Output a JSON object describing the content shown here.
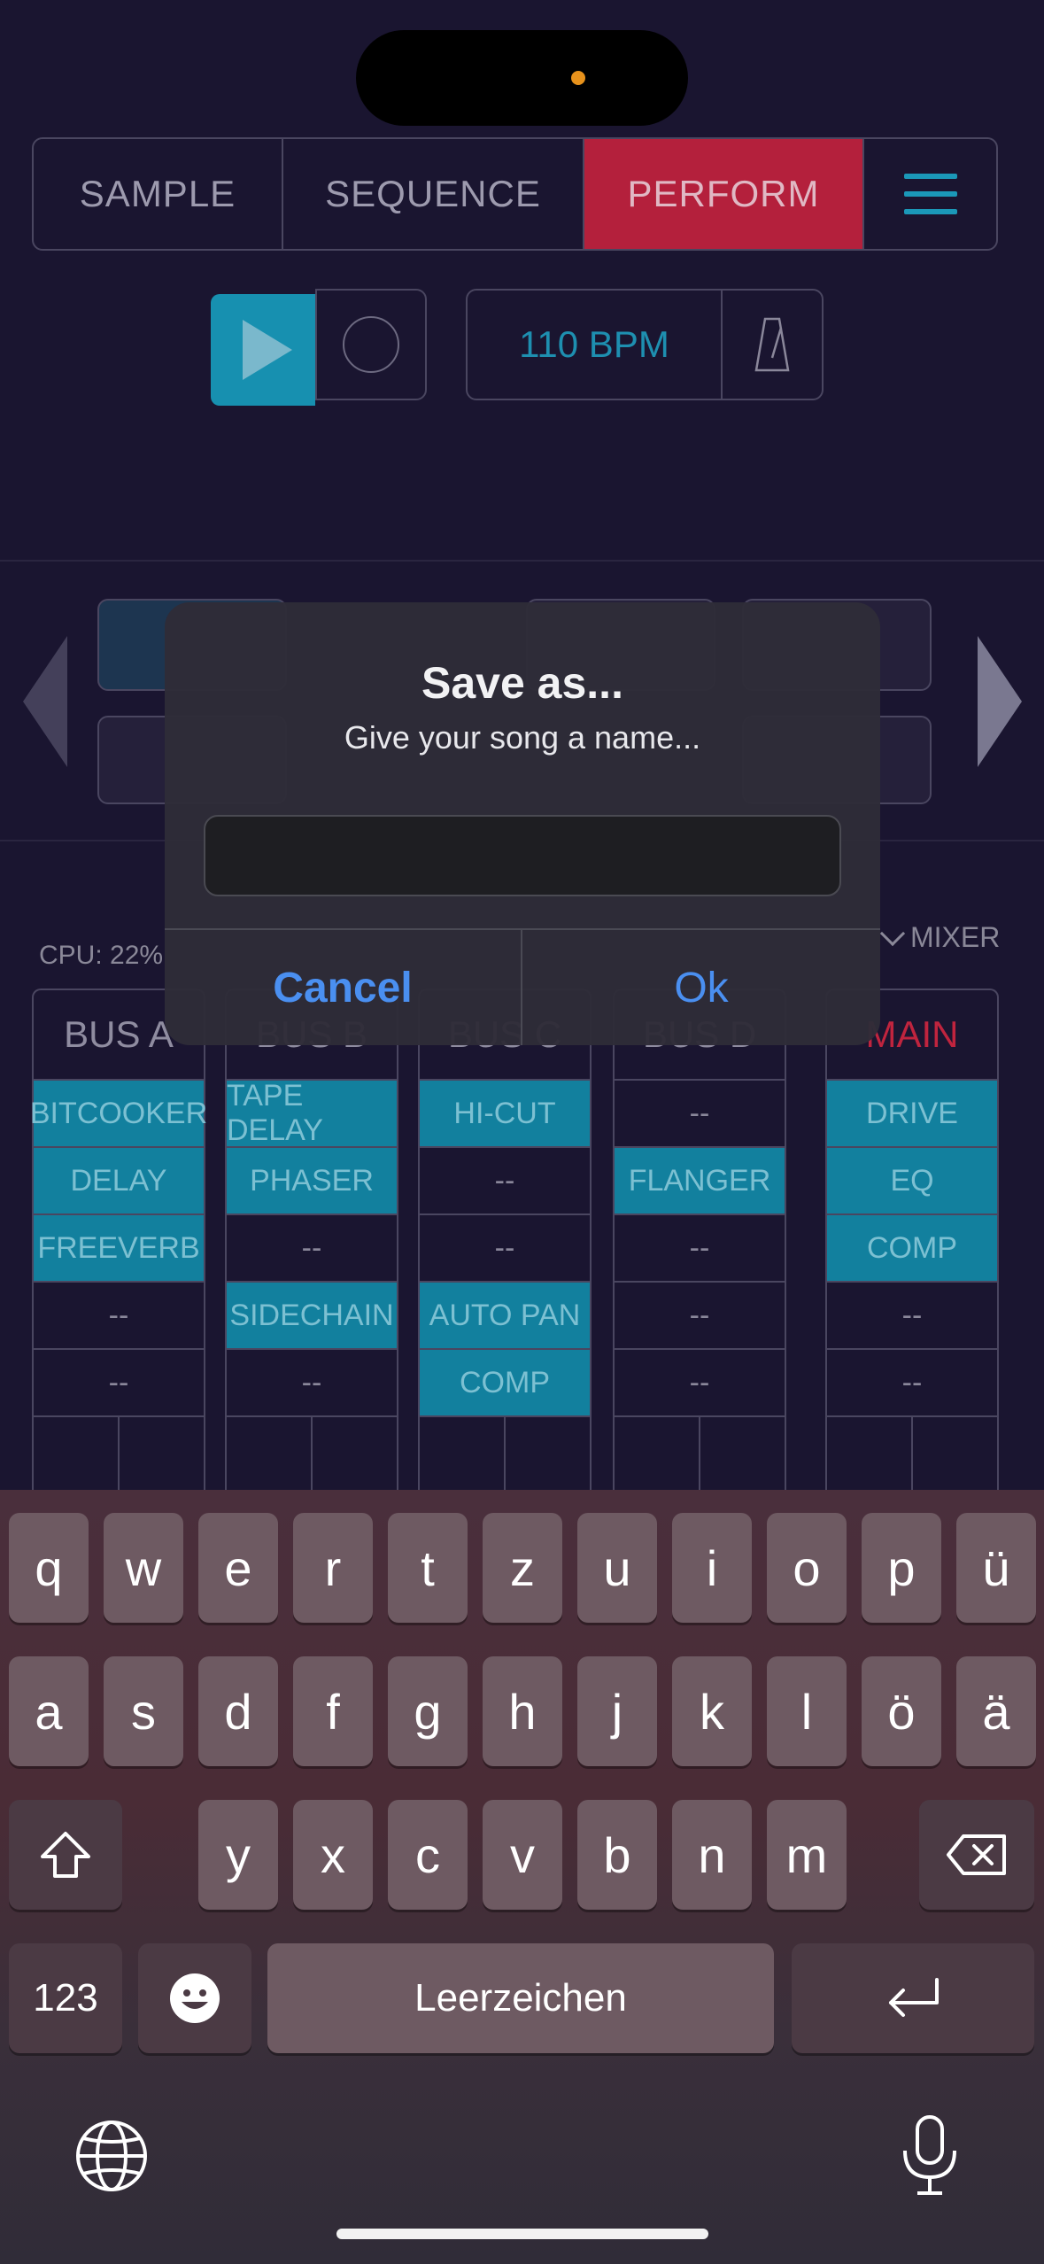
{
  "tabs": {
    "sample": "SAMPLE",
    "sequence": "SEQUENCE",
    "perform": "PERFORM"
  },
  "transport": {
    "bpm": "110 BPM"
  },
  "stats": {
    "cpu": "CPU: 22%",
    "mixer": "MIXER"
  },
  "buses": [
    {
      "name": "BUS A",
      "slots": [
        "BITCOOKER",
        "DELAY",
        "FREEVERB",
        "--",
        "--"
      ],
      "active": [
        true,
        true,
        true,
        false,
        false
      ]
    },
    {
      "name": "BUS B",
      "slots": [
        "TAPE DELAY",
        "PHASER",
        "--",
        "SIDECHAIN",
        "--"
      ],
      "active": [
        true,
        true,
        false,
        true,
        false
      ]
    },
    {
      "name": "BUS C",
      "slots": [
        "HI-CUT",
        "--",
        "--",
        "AUTO PAN",
        "COMP"
      ],
      "active": [
        true,
        false,
        false,
        true,
        true
      ]
    },
    {
      "name": "BUS D",
      "slots": [
        "--",
        "FLANGER",
        "--",
        "--",
        "--"
      ],
      "active": [
        false,
        true,
        false,
        false,
        false
      ]
    },
    {
      "name": "MAIN",
      "slots": [
        "DRIVE",
        "EQ",
        "COMP",
        "--",
        "--"
      ],
      "active": [
        true,
        true,
        true,
        false,
        false
      ]
    }
  ],
  "dialog": {
    "title": "Save as...",
    "message": "Give your song a name...",
    "input_value": "",
    "cancel": "Cancel",
    "ok": "Ok"
  },
  "keyboard": {
    "row1": [
      "q",
      "w",
      "e",
      "r",
      "t",
      "z",
      "u",
      "i",
      "o",
      "p",
      "ü"
    ],
    "row2": [
      "a",
      "s",
      "d",
      "f",
      "g",
      "h",
      "j",
      "k",
      "l",
      "ö",
      "ä"
    ],
    "row3": [
      "y",
      "x",
      "c",
      "v",
      "b",
      "n",
      "m"
    ],
    "numbers": "123",
    "space": "Leerzeichen"
  }
}
